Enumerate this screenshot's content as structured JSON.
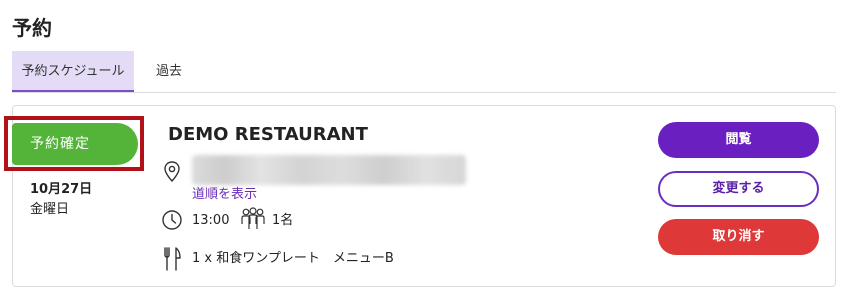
{
  "page": {
    "title": "予約"
  },
  "tabs": [
    {
      "label": "予約スケジュール",
      "active": true
    },
    {
      "label": "過去",
      "active": false
    }
  ],
  "reservation": {
    "status": "予約確定",
    "date": "10月27日",
    "weekday": "金曜日",
    "restaurant": "DEMO RESTAURANT",
    "directions_label": "道順を表示",
    "time": "13:00",
    "guests": "1名",
    "menu": "1 x 和食ワンプレート　メニューB"
  },
  "actions": {
    "view": "閲覧",
    "change": "変更する",
    "cancel": "取り消す"
  },
  "colors": {
    "status_green": "#54b43a",
    "highlight_red": "#b01217",
    "primary_purple": "#6a1fc0",
    "cancel_red": "#de3838",
    "tab_active_bg": "#e4dcf6"
  },
  "icons": [
    "location-pin-icon",
    "clock-icon",
    "people-icon",
    "cutlery-icon"
  ]
}
